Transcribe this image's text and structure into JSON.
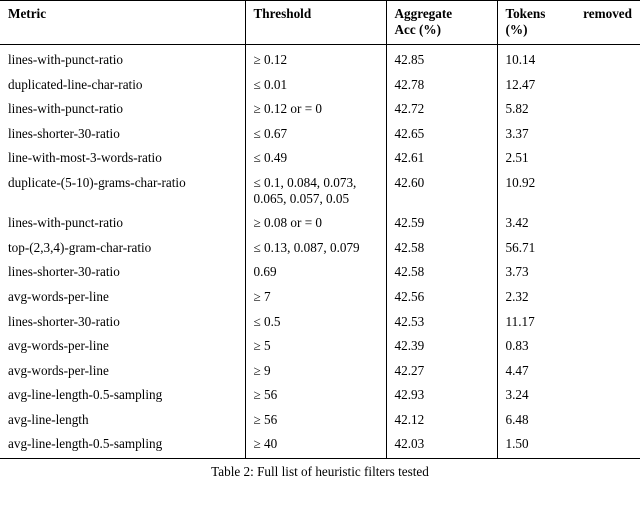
{
  "table": {
    "columns": [
      {
        "key": "metric",
        "label": "Metric"
      },
      {
        "key": "threshold",
        "label": "Threshold"
      },
      {
        "key": "acc",
        "label": "Aggregate Acc (%)"
      },
      {
        "key": "tokens",
        "label": "Tokens removed (%)"
      }
    ],
    "header": {
      "metric": "Metric",
      "threshold": "Threshold",
      "acc_line1": "Aggregate",
      "acc_line2": "Acc (%)",
      "tokens_line1": "Tokens removed",
      "tokens_line2": "(%)"
    },
    "rows": [
      {
        "metric": "lines-with-punct-ratio",
        "threshold": "≥ 0.12",
        "acc": "42.85",
        "tokens": "10.14"
      },
      {
        "metric": "duplicated-line-char-ratio",
        "threshold": "≤ 0.01",
        "acc": "42.78",
        "tokens": "12.47"
      },
      {
        "metric": "lines-with-punct-ratio",
        "threshold": "≥ 0.12 or = 0",
        "acc": "42.72",
        "tokens": "5.82"
      },
      {
        "metric": "lines-shorter-30-ratio",
        "threshold": "≤ 0.67",
        "acc": "42.65",
        "tokens": "3.37"
      },
      {
        "metric": "line-with-most-3-words-ratio",
        "threshold": "≤ 0.49",
        "acc": "42.61",
        "tokens": "2.51"
      },
      {
        "metric": "duplicate-(5-10)-grams-char-ratio",
        "threshold": "≤ 0.1, 0.084, 0.073, 0.065, 0.057, 0.05",
        "acc": "42.60",
        "tokens": "10.92"
      },
      {
        "metric": "lines-with-punct-ratio",
        "threshold": "≥ 0.08 or = 0",
        "acc": "42.59",
        "tokens": "3.42"
      },
      {
        "metric": "top-(2,3,4)-gram-char-ratio",
        "threshold": "≤ 0.13, 0.087, 0.079",
        "acc": "42.58",
        "tokens": "56.71"
      },
      {
        "metric": "lines-shorter-30-ratio",
        "threshold": "0.69",
        "acc": "42.58",
        "tokens": "3.73"
      },
      {
        "metric": "avg-words-per-line",
        "threshold": "≥ 7",
        "acc": "42.56",
        "tokens": "2.32"
      },
      {
        "metric": "lines-shorter-30-ratio",
        "threshold": "≤ 0.5",
        "acc": "42.53",
        "tokens": "11.17"
      },
      {
        "metric": "avg-words-per-line",
        "threshold": "≥ 5",
        "acc": "42.39",
        "tokens": "0.83"
      },
      {
        "metric": "avg-words-per-line",
        "threshold": "≥ 9",
        "acc": "42.27",
        "tokens": "4.47"
      },
      {
        "metric": "avg-line-length-0.5-sampling",
        "threshold": "≥ 56",
        "acc": "42.93",
        "tokens": "3.24"
      },
      {
        "metric": "avg-line-length",
        "threshold": "≥ 56",
        "acc": "42.12",
        "tokens": "6.48"
      },
      {
        "metric": "avg-line-length-0.5-sampling",
        "threshold": "≥ 40",
        "acc": "42.03",
        "tokens": "1.50"
      }
    ]
  },
  "caption": "Table 2: Full list of heuristic filters tested"
}
